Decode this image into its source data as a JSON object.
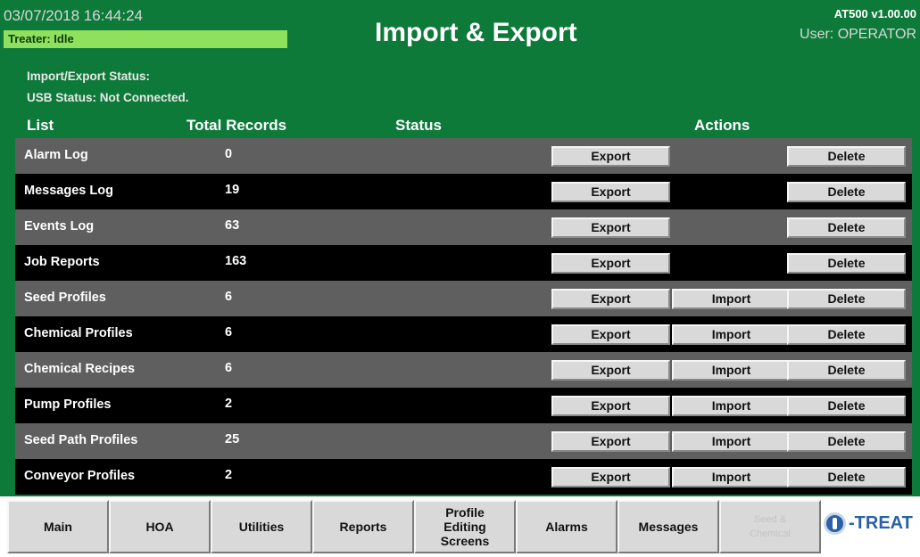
{
  "header": {
    "datetime": "03/07/2018 16:44:24",
    "treater_status": "Treater: Idle",
    "title": "Import & Export",
    "version": "AT500 v1.00.00",
    "user": "User: OPERATOR"
  },
  "status": {
    "import_export": "Import/Export Status:",
    "usb": "USB Status: Not Connected."
  },
  "columns": {
    "list": "List",
    "total_records": "Total Records",
    "status": "Status",
    "actions": "Actions"
  },
  "buttons": {
    "export": "Export",
    "import": "Import",
    "delete": "Delete"
  },
  "rows": [
    {
      "name": "Alarm Log",
      "count": "0"
    },
    {
      "name": "Messages Log",
      "count": "19"
    },
    {
      "name": "Events Log",
      "count": "63"
    },
    {
      "name": "Job Reports",
      "count": "163"
    },
    {
      "name": "Seed Profiles",
      "count": "6"
    },
    {
      "name": "Chemical Profiles",
      "count": "6"
    },
    {
      "name": "Chemical Recipes",
      "count": "6"
    },
    {
      "name": "Pump Profiles",
      "count": "2"
    },
    {
      "name": "Seed Path Profiles",
      "count": "25"
    },
    {
      "name": "Conveyor Profiles",
      "count": "2"
    }
  ],
  "nav": {
    "main": "Main",
    "hoa": "HOA",
    "utilities": "Utilities",
    "reports": "Reports",
    "profile_line1": "Profile",
    "profile_line2": "Editing",
    "profile_line3": "Screens",
    "alarms": "Alarms",
    "messages": "Messages",
    "disabled_line1": "Seed &",
    "disabled_line2": "Chemical",
    "logo": "-TREAT"
  },
  "colors": {
    "background_green": "#0e7a3a",
    "treater_status_green": "#8fe05c",
    "row_grey": "#5f5f5f",
    "row_black": "#000000",
    "button_grey": "#d9d9d9",
    "logo_blue": "#2b5fa8"
  },
  "icons": {
    "logo": "u-treat-logo-icon"
  }
}
